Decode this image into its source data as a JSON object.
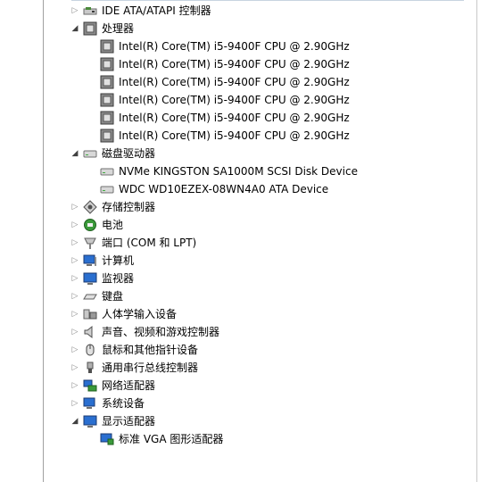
{
  "tree": {
    "ide": {
      "label": "IDE ATA/ATAPI 控制器",
      "icon": "ide-controller-icon"
    },
    "processors": {
      "label": "处理器",
      "icon": "processor-icon",
      "items": [
        "Intel(R) Core(TM) i5-9400F CPU @ 2.90GHz",
        "Intel(R) Core(TM) i5-9400F CPU @ 2.90GHz",
        "Intel(R) Core(TM) i5-9400F CPU @ 2.90GHz",
        "Intel(R) Core(TM) i5-9400F CPU @ 2.90GHz",
        "Intel(R) Core(TM) i5-9400F CPU @ 2.90GHz",
        "Intel(R) Core(TM) i5-9400F CPU @ 2.90GHz"
      ]
    },
    "disks": {
      "label": "磁盘驱动器",
      "icon": "disk-drive-icon",
      "items": [
        "NVMe KINGSTON SA1000M SCSI Disk Device",
        "WDC WD10EZEX-08WN4A0 ATA Device"
      ]
    },
    "storage": {
      "label": "存储控制器",
      "icon": "storage-controller-icon"
    },
    "battery": {
      "label": "电池",
      "icon": "battery-icon"
    },
    "ports": {
      "label": "端口 (COM 和 LPT)",
      "icon": "port-icon"
    },
    "computer": {
      "label": "计算机",
      "icon": "computer-icon"
    },
    "monitors": {
      "label": "监视器",
      "icon": "monitor-icon"
    },
    "keyboards": {
      "label": "键盘",
      "icon": "keyboard-icon"
    },
    "hid": {
      "label": "人体学输入设备",
      "icon": "hid-icon"
    },
    "sound": {
      "label": "声音、视频和游戏控制器",
      "icon": "speaker-icon"
    },
    "mice": {
      "label": "鼠标和其他指针设备",
      "icon": "mouse-icon"
    },
    "usb": {
      "label": "通用串行总线控制器",
      "icon": "usb-icon"
    },
    "network": {
      "label": "网络适配器",
      "icon": "network-adapter-icon"
    },
    "system": {
      "label": "系统设备",
      "icon": "system-device-icon"
    },
    "display": {
      "label": "显示适配器",
      "icon": "display-adapter-icon",
      "items": [
        "标准 VGA 图形适配器"
      ]
    }
  }
}
